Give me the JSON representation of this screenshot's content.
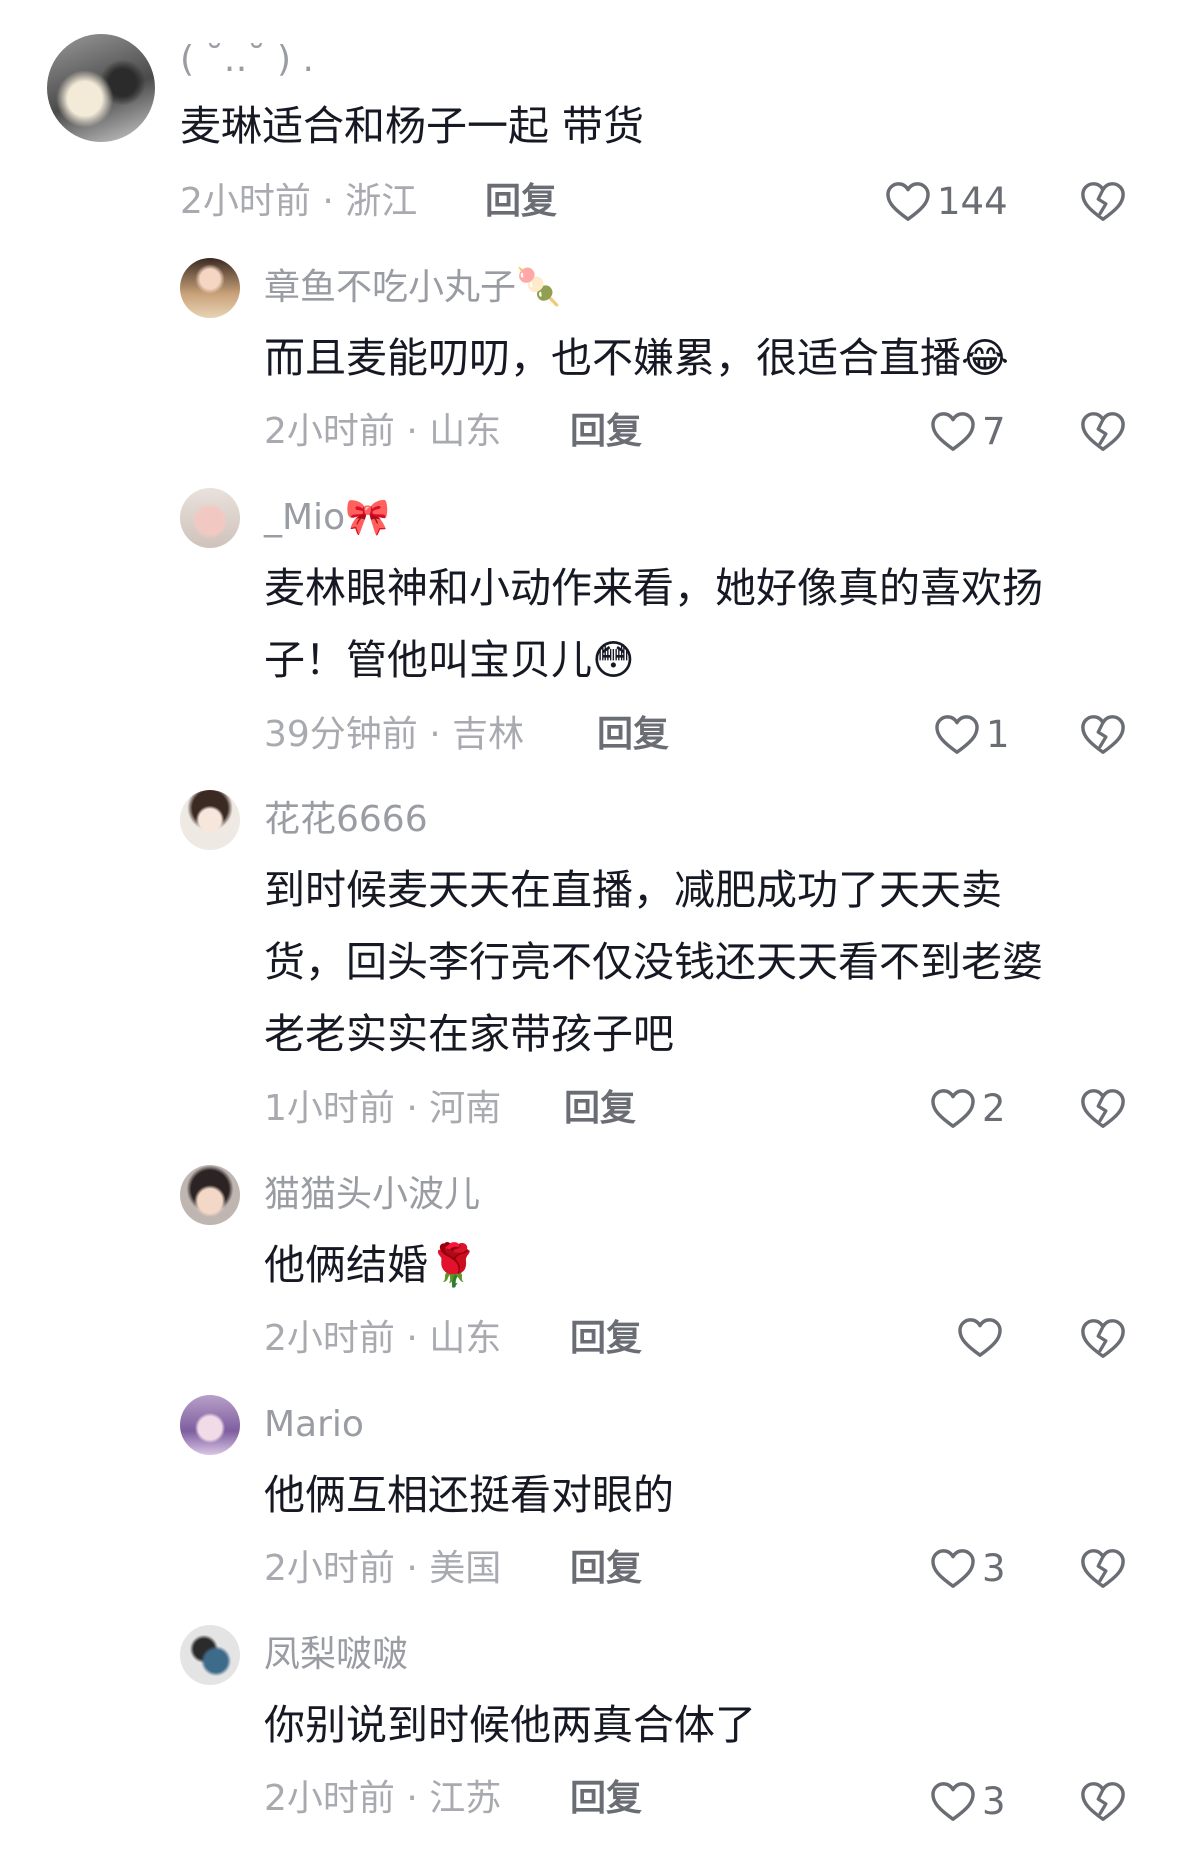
{
  "comments": [
    {
      "username": "( ˘‥˘ ) .",
      "text": "麦琳适合和杨子一起 带货",
      "meta": "2小时前 · 浙江",
      "reply_label": "回复",
      "likes": "144"
    },
    {
      "username": "章鱼不吃小丸子🍡",
      "text": "而且麦能叨叨，也不嫌累，很适合直播😂",
      "meta": "2小时前 · 山东",
      "reply_label": "回复",
      "likes": "7"
    },
    {
      "username": "_Mio🎀",
      "text_lines": [
        "麦林眼神和小动作来看，她好像真的喜欢扬",
        "子！管他叫宝贝儿😳"
      ],
      "meta": "39分钟前 · 吉林",
      "reply_label": "回复",
      "likes": "1"
    },
    {
      "username": "花花6666",
      "text_lines": [
        "到时候麦天天在直播，减肥成功了天天卖",
        "货，回头李行亮不仅没钱还天天看不到老婆",
        "老老实实在家带孩子吧"
      ],
      "meta": "1小时前 · 河南",
      "reply_label": "回复",
      "likes": "2"
    },
    {
      "username": "猫猫头小波儿",
      "text": "他俩结婚🌹",
      "meta": "2小时前 · 山东",
      "reply_label": "回复",
      "likes": ""
    },
    {
      "username": "Mario",
      "text": "他俩互相还挺看对眼的",
      "meta": "2小时前 · 美国",
      "reply_label": "回复",
      "likes": "3"
    },
    {
      "username": "凤梨啵啵",
      "text": "你别说到时候他两真合体了",
      "meta": "2小时前 · 江苏",
      "reply_label": "回复",
      "likes": "3"
    }
  ],
  "icons": {
    "like": "heart-outline-icon",
    "dislike": "broken-heart-icon"
  },
  "colors": {
    "text": "#161823",
    "secondary": "#a8aab0",
    "reply": "#6b6d74"
  }
}
